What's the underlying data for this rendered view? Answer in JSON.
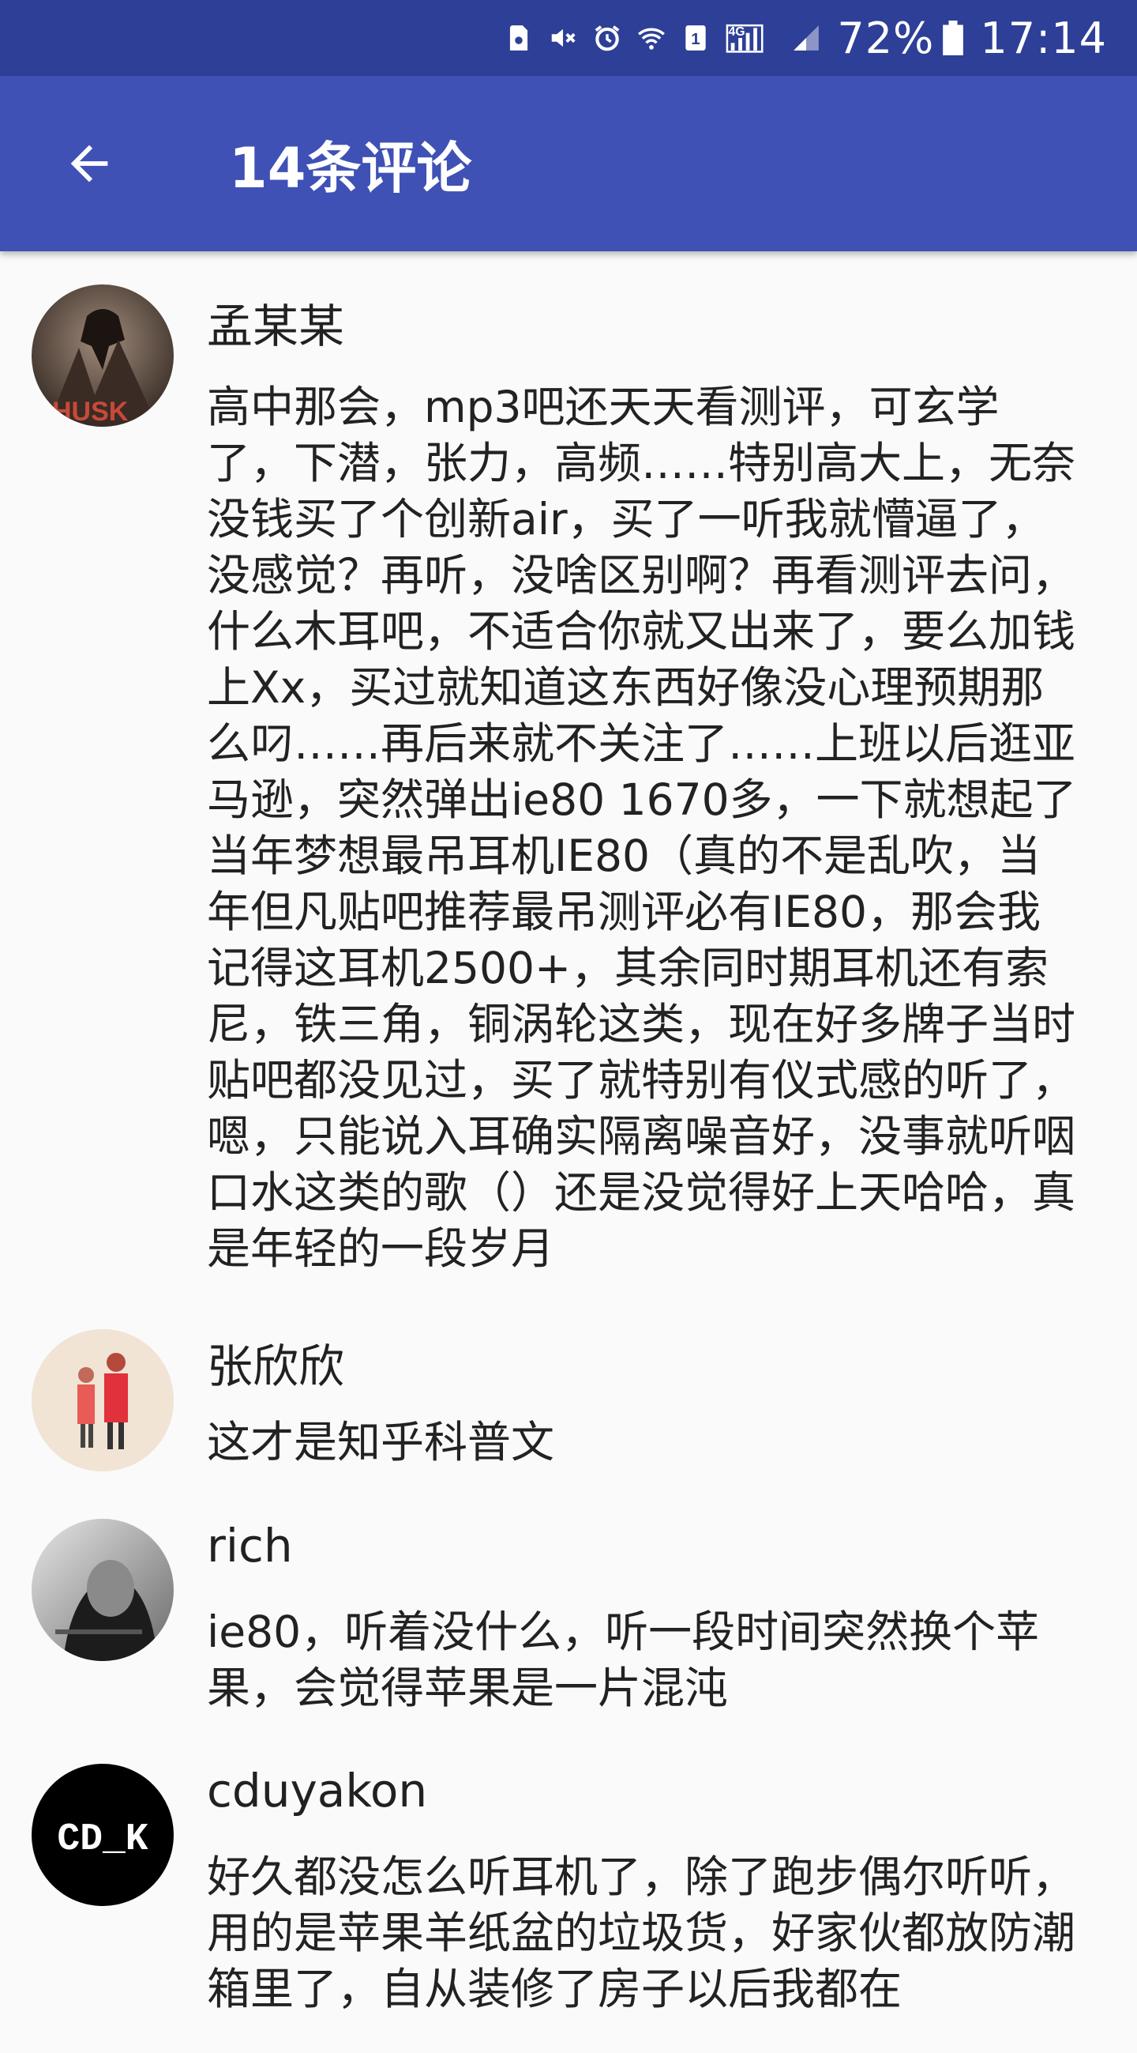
{
  "status_bar": {
    "network_type": "4G",
    "sim_slot": "1",
    "battery_percent": "72%",
    "time": "17:14",
    "icons": [
      "sim-card-icon",
      "vibrate-mute-icon",
      "alarm-icon",
      "wifi-icon",
      "sim-slot-icon",
      "signal-4g-icon",
      "signal-icon",
      "battery-icon"
    ]
  },
  "toolbar": {
    "back_icon": "arrow-left-icon",
    "title": "14条评论"
  },
  "colors": {
    "status_bar": "#2e3f97",
    "toolbar": "#3f51b5",
    "background": "#fafafa"
  },
  "comments": [
    {
      "author": "孟某某",
      "avatar_text": "HUSK",
      "content": "高中那会，mp3吧还天天看测评，可玄学了，下潜，张力，高频……特别高大上，无奈没钱买了个创新air，买了一听我就懵逼了，没感觉？再听，没啥区别啊？再看测评去问，什么木耳吧，不适合你就又出来了，要么加钱上Xx，买过就知道这东西好像没心理预期那么叼……再后来就不关注了……上班以后逛亚马逊，突然弹出ie80 1670多，一下就想起了当年梦想最吊耳机IE80（真的不是乱吹，当年但凡贴吧推荐最吊测评必有IE80，那会我记得这耳机2500+，其余同时期耳机还有索尼，铁三角，铜涡轮这类，现在好多牌子当时贴吧都没见过，买了就特别有仪式感的听了，嗯，只能说入耳确实隔离噪音好，没事就听咽口水这类的歌（）还是没觉得好上天哈哈，真是年轻的一段岁月"
    },
    {
      "author": "张欣欣",
      "content": "这才是知乎科普文"
    },
    {
      "author": "rich",
      "content": "ie80，听着没什么，听一段时间突然换个苹果，会觉得苹果是一片混沌"
    },
    {
      "author": "cduyakon",
      "avatar_text": "CD_K",
      "content": "好久都没怎么听耳机了，除了跑步偶尔听听，用的是苹果羊纸盆的垃圾货，好家伙都放防潮箱里了，自从装修了房子以后我都在"
    }
  ]
}
